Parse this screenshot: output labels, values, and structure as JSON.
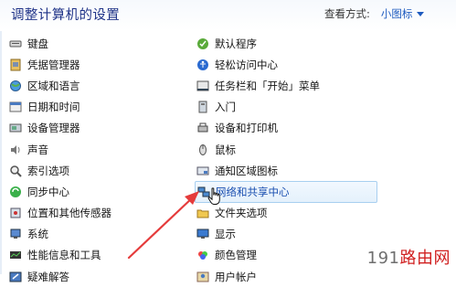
{
  "header": {
    "title": "调整计算机的设置",
    "view_by_label": "查看方式:",
    "view_by_value": "小图标"
  },
  "left_items": [
    {
      "label": "键盘",
      "icon": "keyboard-icon"
    },
    {
      "label": "凭据管理器",
      "icon": "credential-manager-icon"
    },
    {
      "label": "区域和语言",
      "icon": "region-language-icon"
    },
    {
      "label": "日期和时间",
      "icon": "date-time-icon"
    },
    {
      "label": "设备管理器",
      "icon": "device-manager-icon"
    },
    {
      "label": "声音",
      "icon": "sound-icon"
    },
    {
      "label": "索引选项",
      "icon": "indexing-options-icon"
    },
    {
      "label": "同步中心",
      "icon": "sync-center-icon"
    },
    {
      "label": "位置和其他传感器",
      "icon": "location-sensors-icon"
    },
    {
      "label": "系统",
      "icon": "system-icon"
    },
    {
      "label": "性能信息和工具",
      "icon": "performance-tools-icon"
    },
    {
      "label": "疑难解答",
      "icon": "troubleshooting-icon"
    }
  ],
  "right_items": [
    {
      "label": "默认程序",
      "icon": "default-programs-icon"
    },
    {
      "label": "轻松访问中心",
      "icon": "ease-of-access-icon"
    },
    {
      "label": "任务栏和「开始」菜单",
      "icon": "taskbar-start-menu-icon"
    },
    {
      "label": "入门",
      "icon": "getting-started-icon"
    },
    {
      "label": "设备和打印机",
      "icon": "devices-printers-icon"
    },
    {
      "label": "鼠标",
      "icon": "mouse-icon"
    },
    {
      "label": "通知区域图标",
      "icon": "notification-area-icon"
    },
    {
      "label": "网络和共享中心",
      "icon": "network-sharing-icon"
    },
    {
      "label": "文件夹选项",
      "icon": "folder-options-icon"
    },
    {
      "label": "显示",
      "icon": "display-icon"
    },
    {
      "label": "颜色管理",
      "icon": "color-management-icon"
    },
    {
      "label": "用户帐户",
      "icon": "user-accounts-icon"
    }
  ],
  "highlighted_item": "网络和共享中心",
  "watermark": {
    "number": "191",
    "text": "路由网"
  },
  "colors": {
    "title": "#1e3287",
    "link": "#1e5bbf",
    "arrow": "#e53b3b",
    "highlight_border": "#a8cff0"
  }
}
